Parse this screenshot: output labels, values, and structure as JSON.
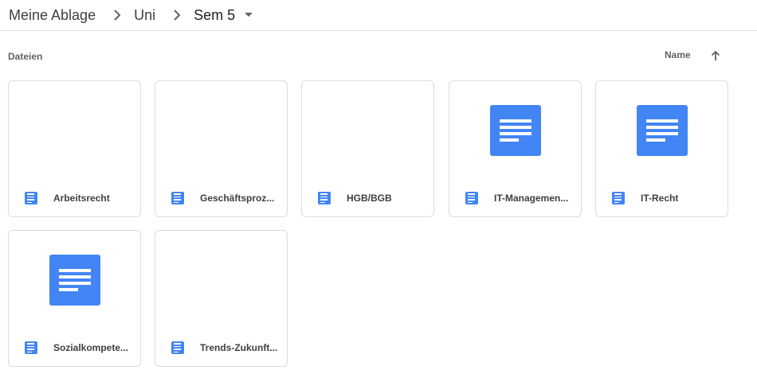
{
  "breadcrumb": {
    "items": [
      "Meine Ablage",
      "Uni",
      "Sem 5"
    ],
    "separator_icon": "chevron-right-icon",
    "dropdown_icon": "arrow-drop-down-icon"
  },
  "section": {
    "title": "Dateien",
    "sort_label": "Name",
    "sort_icon": "arrow-upward-icon"
  },
  "files": [
    {
      "name": "Arbeitsrecht",
      "type_icon": "google-docs-icon",
      "has_thumbnail": false
    },
    {
      "name": "Geschäftsproz...",
      "type_icon": "google-docs-icon",
      "has_thumbnail": false
    },
    {
      "name": "HGB/BGB",
      "type_icon": "google-docs-icon",
      "has_thumbnail": false
    },
    {
      "name": "IT-Managemen...",
      "type_icon": "google-docs-icon",
      "has_thumbnail": true
    },
    {
      "name": "IT-Recht",
      "type_icon": "google-docs-icon",
      "has_thumbnail": true
    },
    {
      "name": "Sozialkompete...",
      "type_icon": "google-docs-icon",
      "has_thumbnail": true
    },
    {
      "name": "Trends-Zukunft...",
      "type_icon": "google-docs-icon",
      "has_thumbnail": false
    }
  ],
  "colors": {
    "docs_blue": "#4285f4",
    "border": "#dadce0",
    "text": "#3c4043",
    "muted": "#5f6368"
  }
}
